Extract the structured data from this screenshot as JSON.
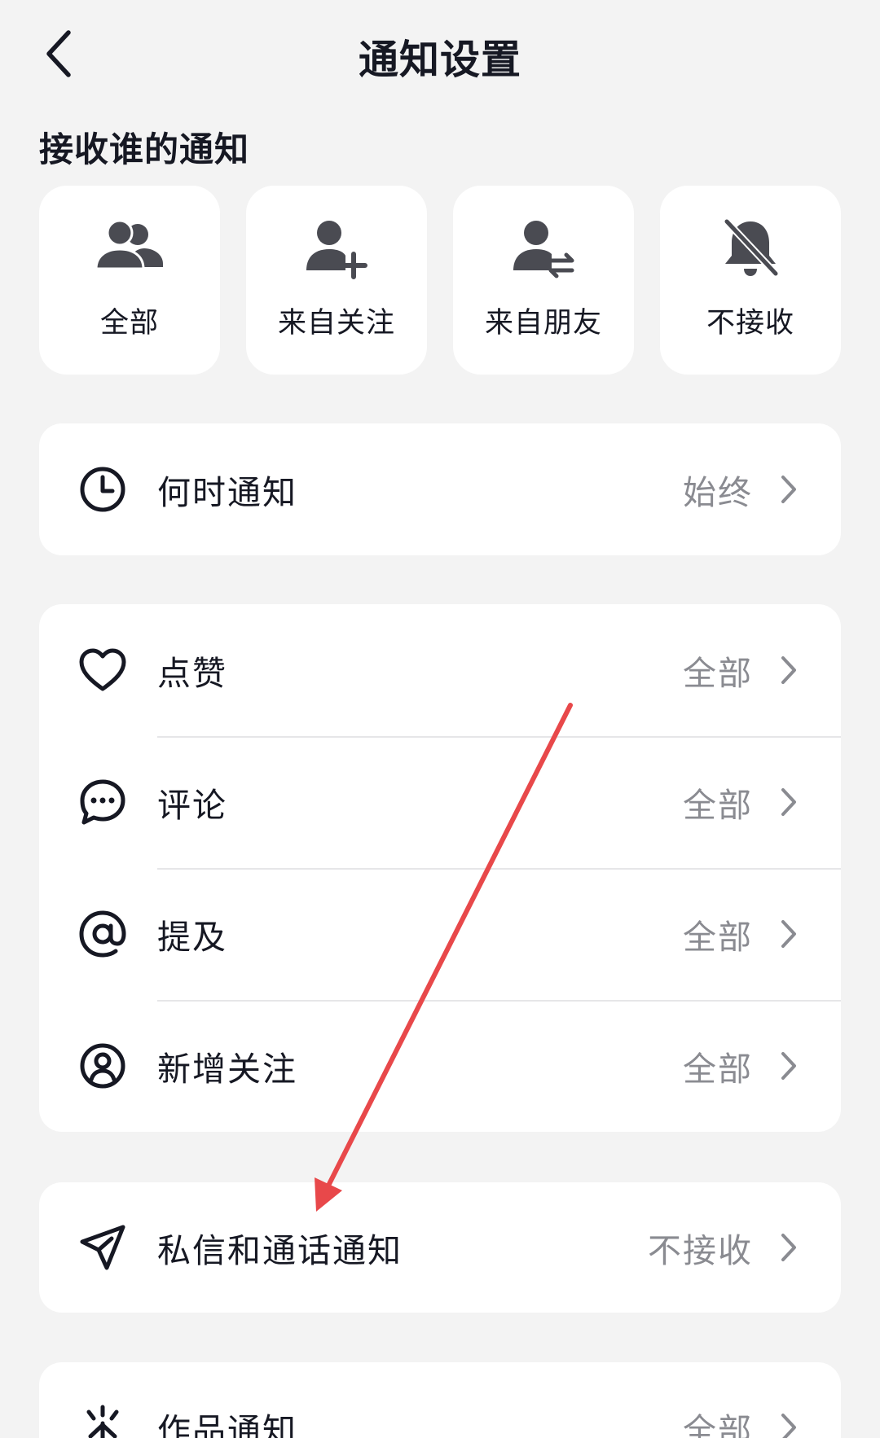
{
  "header": {
    "title": "通知设置"
  },
  "who_section": {
    "title": "接收谁的通知",
    "options": [
      {
        "label": "全部",
        "icon": "group-icon"
      },
      {
        "label": "来自关注",
        "icon": "user-add-icon"
      },
      {
        "label": "来自朋友",
        "icon": "user-exchange-icon"
      },
      {
        "label": "不接收",
        "icon": "bell-off-icon"
      }
    ]
  },
  "when": {
    "label": "何时通知",
    "value": "始终",
    "icon": "clock-icon"
  },
  "interactions": [
    {
      "label": "点赞",
      "value": "全部",
      "icon": "heart-icon"
    },
    {
      "label": "评论",
      "value": "全部",
      "icon": "comment-icon"
    },
    {
      "label": "提及",
      "value": "全部",
      "icon": "at-icon"
    },
    {
      "label": "新增关注",
      "value": "全部",
      "icon": "user-circle-icon"
    }
  ],
  "messages": {
    "label": "私信和通话通知",
    "value": "不接收",
    "icon": "send-icon"
  },
  "works": {
    "label": "作品通知",
    "value": "全部",
    "icon": "sparkle-icon"
  },
  "colors": {
    "background": "#f3f3f3",
    "card": "#ffffff",
    "text_primary": "#161823",
    "text_secondary": "#8a8b91",
    "icon_fill": "#4a4b52",
    "annotation_arrow": "#e8484a"
  }
}
